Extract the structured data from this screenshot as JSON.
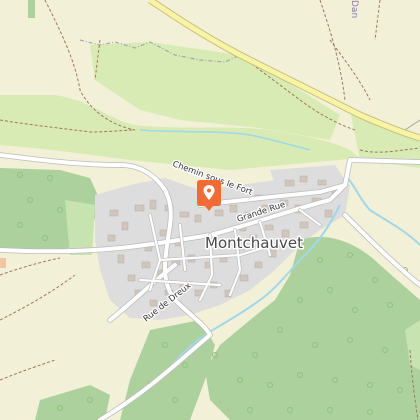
{
  "map": {
    "place_name": "Montchauvet",
    "streets": {
      "chemin_sous_le_fort": "Chemin sous le Fort",
      "grande_rue": "Grande Rue",
      "rue_de_dreux": "Rue de Dreux"
    },
    "edge_label": "Dan",
    "marker": {
      "icon": "map-pin-icon",
      "color": "#f26b35"
    },
    "colors": {
      "farmland": "#f3f0d8",
      "meadow": "#d8ebb5",
      "forest": "#add19d",
      "residential": "#dddddd",
      "building": "#cfc6bd",
      "water": "#a0d8e8",
      "major_road": "#f7f4a6",
      "track": "#9c7a5a",
      "boundary": "#a7a7a7"
    }
  }
}
